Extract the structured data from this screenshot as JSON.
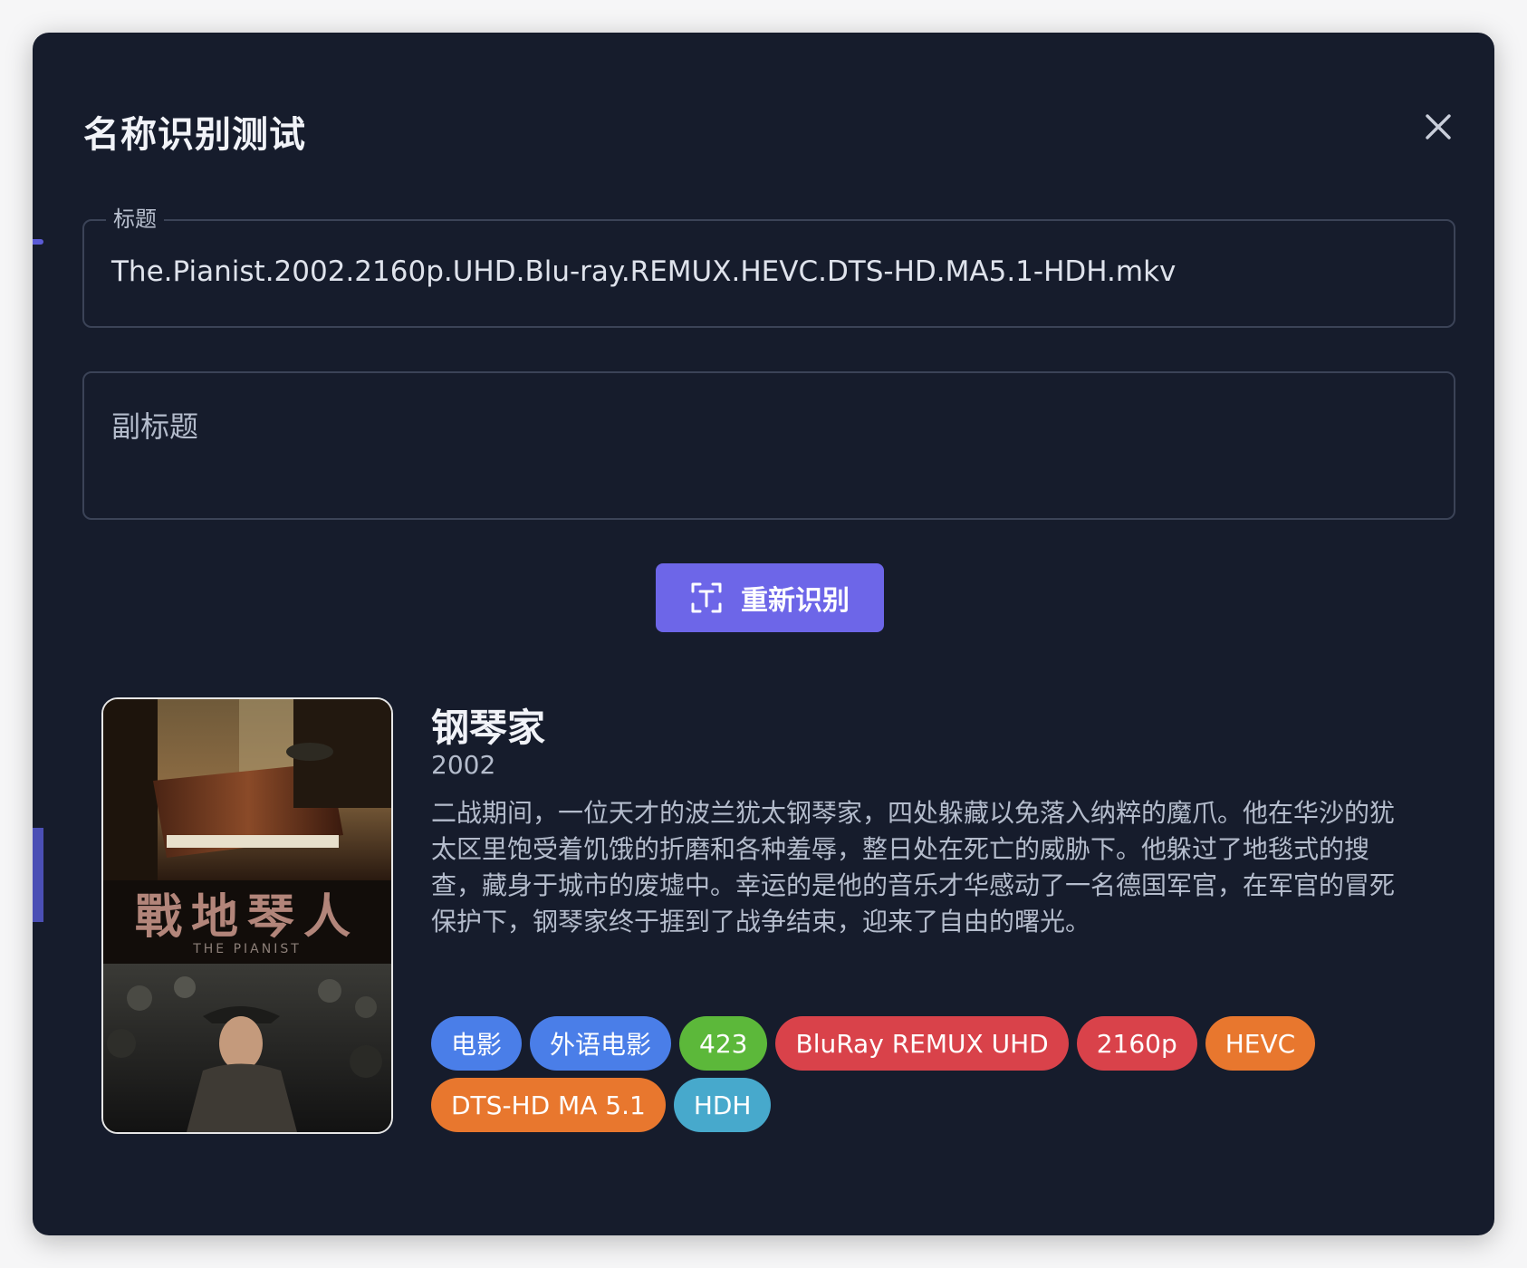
{
  "dialog": {
    "title": "名称识别测试",
    "close_icon": "close-icon"
  },
  "form": {
    "title_label": "标题",
    "title_value": "The.Pianist.2002.2160p.UHD.Blu-ray.REMUX.HEVC.DTS-HD.MA5.1-HDH.mkv",
    "subtitle_placeholder": "副标题"
  },
  "actions": {
    "recognize_label": "重新识别",
    "recognize_icon": "text-recognition-icon"
  },
  "result": {
    "poster": {
      "title_cn": "戰地琴人",
      "title_en": "THE PIANIST"
    },
    "title": "钢琴家",
    "year": "2002",
    "overview": "二战期间，一位天才的波兰犹太钢琴家，四处躲藏以免落入纳粹的魔爪。他在华沙的犹太区里饱受着饥饿的折磨和各种羞辱，整日处在死亡的威胁下。他躲过了地毯式的搜查，藏身于城市的废墟中。幸运的是他的音乐才华感动了一名德国军官，在军官的冒死保护下，钢琴家终于捱到了战争结束，迎来了自由的曙光。",
    "tags": [
      {
        "label": "电影",
        "color": "#4a7ee8"
      },
      {
        "label": "外语电影",
        "color": "#4a7ee8"
      },
      {
        "label": "423",
        "color": "#5cb83a"
      },
      {
        "label": "BluRay REMUX UHD",
        "color": "#d9424a"
      },
      {
        "label": "2160p",
        "color": "#d9424a"
      },
      {
        "label": "HEVC",
        "color": "#e8772e"
      },
      {
        "label": "DTS-HD MA 5.1",
        "color": "#e8772e"
      },
      {
        "label": "HDH",
        "color": "#47a9cc"
      }
    ]
  },
  "colors": {
    "dialog_bg": "#161c2c",
    "accent": "#6d66e8",
    "field_border": "#3b4357"
  }
}
